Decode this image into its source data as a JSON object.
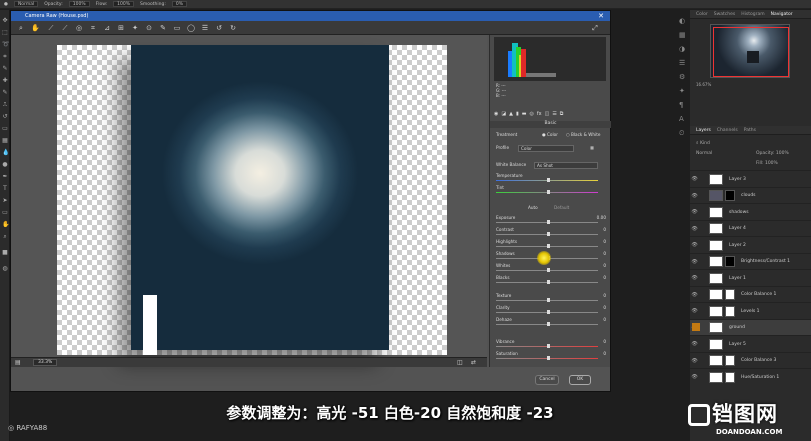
{
  "ps_options": {
    "mode": "Normal",
    "opacity_label": "Opacity:",
    "opacity": "100%",
    "flow_label": "Flow:",
    "flow": "100%",
    "smoothing_label": "Smoothing:",
    "smoothing": "0%"
  },
  "dialog": {
    "title": "Camera Raw (House.psd)",
    "zoom": "33.3%",
    "cancel": "Cancel",
    "ok": "OK"
  },
  "histogram": {
    "r": "R:   ---",
    "g": "G:   ---",
    "b": "B:   ---"
  },
  "basic": {
    "title": "Basic",
    "treatment_label": "Treatment",
    "color_opt": "Color",
    "bw_opt": "Black & White",
    "profile_label": "Profile",
    "profile_value": "Color",
    "wb_label": "White Balance",
    "wb_value": "As Shot",
    "auto": "Auto",
    "default": "Default",
    "sliders": [
      {
        "label": "Temperature",
        "value": "",
        "pos": 0.5
      },
      {
        "label": "Tint",
        "value": "",
        "pos": 0.5
      },
      {
        "label": "Exposure",
        "value": "0.00",
        "pos": 0.5
      },
      {
        "label": "Contrast",
        "value": "0",
        "pos": 0.5
      },
      {
        "label": "Highlights",
        "value": "0",
        "pos": 0.5
      },
      {
        "label": "Shadows",
        "value": "0",
        "pos": 0.5
      },
      {
        "label": "Whites",
        "value": "0",
        "pos": 0.5
      },
      {
        "label": "Blacks",
        "value": "0",
        "pos": 0.5
      },
      {
        "label": "Texture",
        "value": "0",
        "pos": 0.5
      },
      {
        "label": "Clarity",
        "value": "0",
        "pos": 0.5
      },
      {
        "label": "Dehaze",
        "value": "0",
        "pos": 0.5
      },
      {
        "label": "Vibrance",
        "value": "0",
        "pos": 0.5
      },
      {
        "label": "Saturation",
        "value": "0",
        "pos": 0.5
      }
    ]
  },
  "right_tabs": {
    "color": "Color",
    "swatches": "Swatches",
    "histogram": "Histogram",
    "navigator": "Navigator"
  },
  "nav_zoom": "16.67%",
  "layers_tabs": {
    "layers": "Layers",
    "channels": "Channels",
    "paths": "Paths"
  },
  "layers_filter": "Kind",
  "blend": "Normal",
  "opacity": "Opacity: 100%",
  "fill": "Fill: 100%",
  "layers": [
    "Layer 3",
    "clouds",
    "shadows",
    "Layer 4",
    "Layer 2",
    "Brightness/Contrast 1",
    "Layer 1",
    "Color Balance 1",
    "Levels 1",
    "ground",
    "Layer 5",
    "Color Balance 3",
    "Hue/Saturation 1"
  ],
  "subtitle": "参数调整为：高光 -51 白色-20 自然饱和度 -23",
  "handle": "RAFYA88",
  "watermark": {
    "logo": "铛图网",
    "url": "DOANDOAN.COM"
  }
}
